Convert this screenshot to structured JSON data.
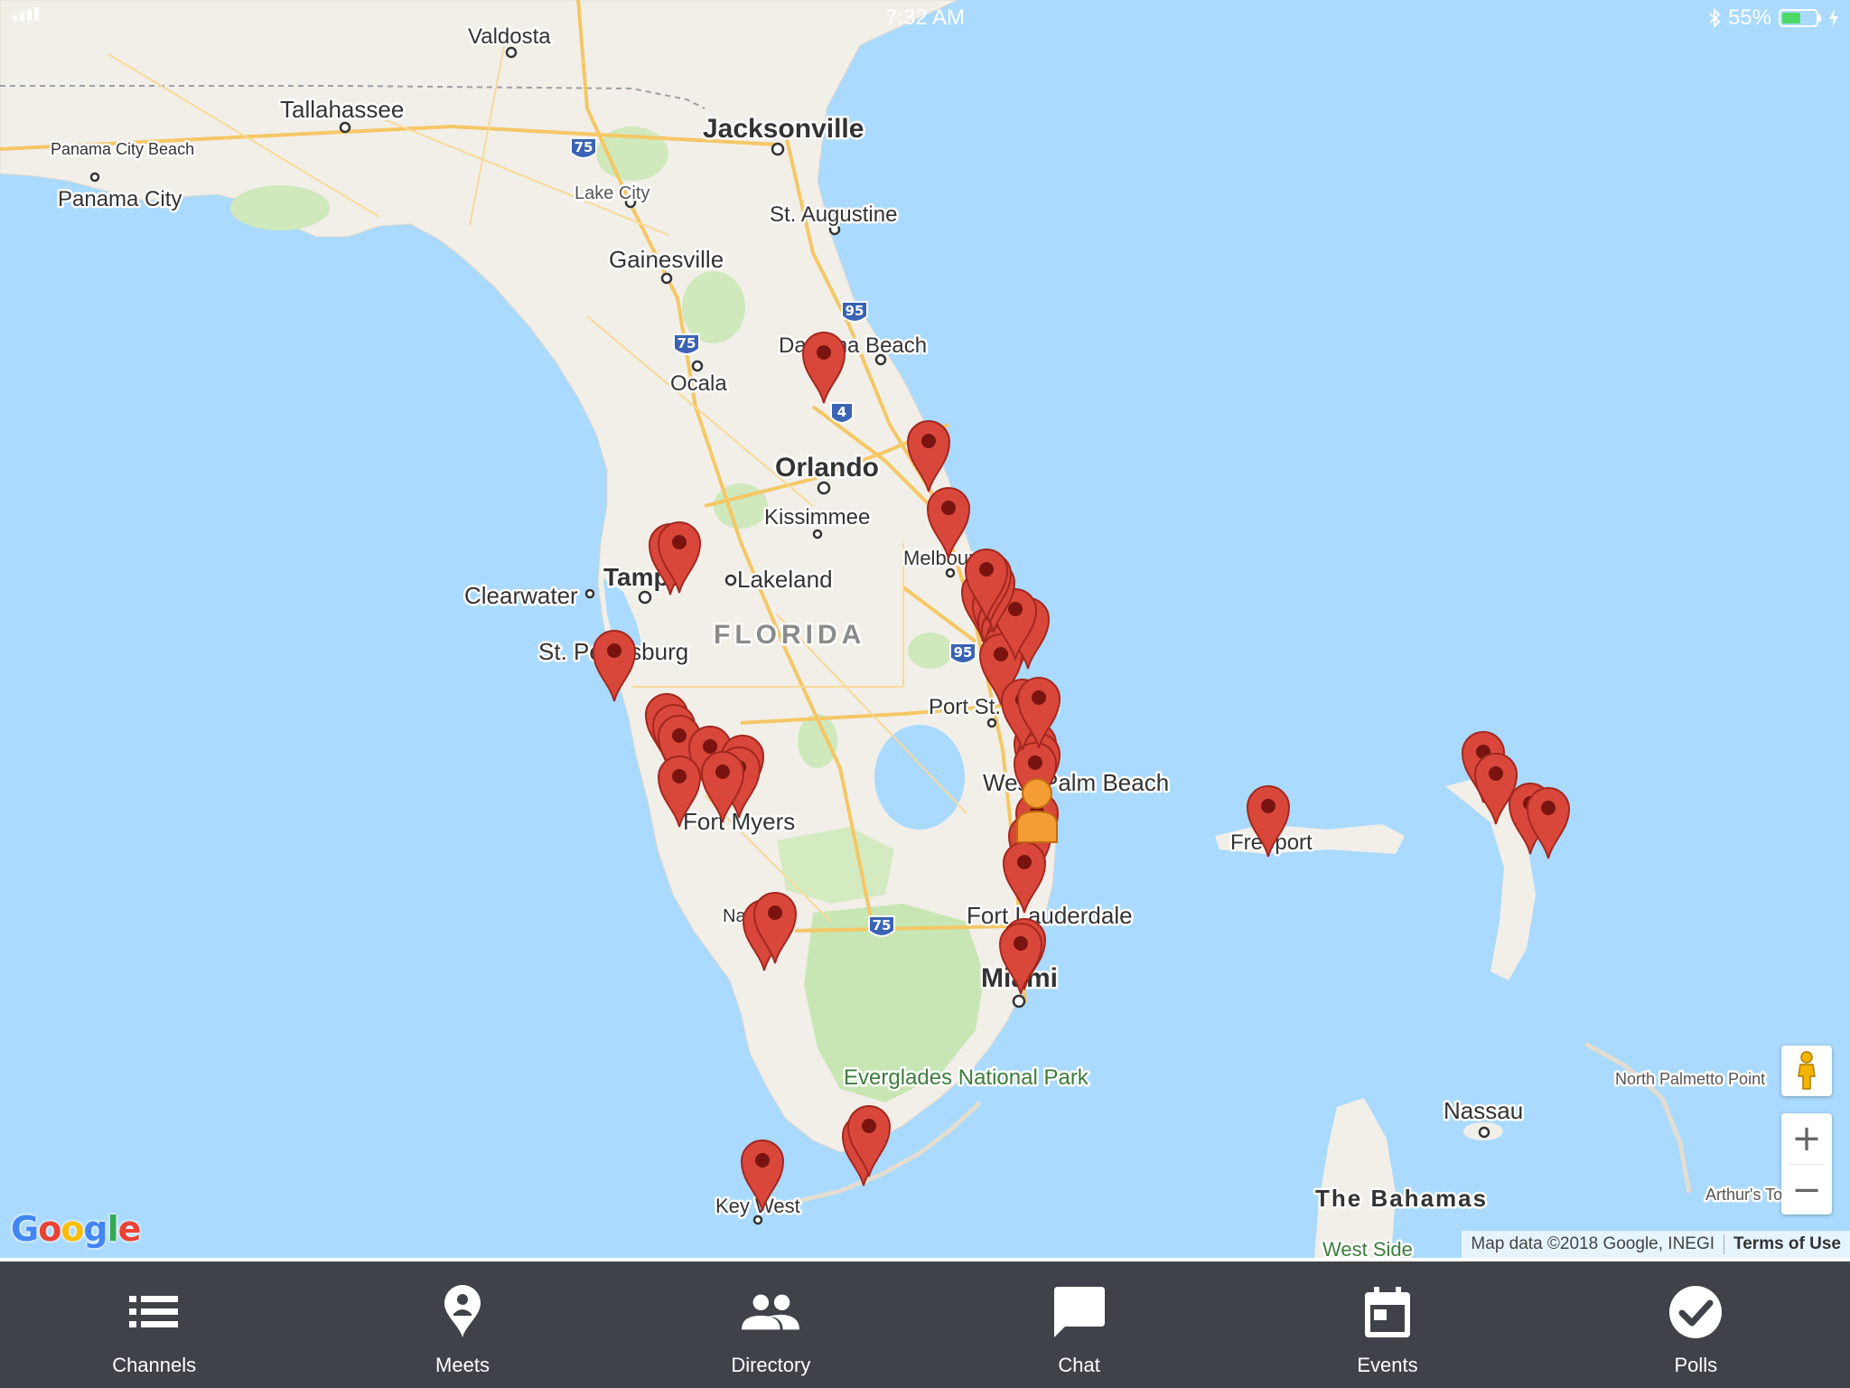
{
  "status_bar": {
    "time": "7:32 AM",
    "battery_percent": "55%",
    "battery_level": 0.55,
    "icons": [
      "signal-icon",
      "bluetooth-icon",
      "battery-icon",
      "charging-icon"
    ]
  },
  "colors": {
    "water": "#aadaff",
    "land": "#f2efe9",
    "park": "#c8e6b4",
    "highway": "#f7c96a",
    "pin": "#d9473b",
    "pin_dot": "#7a1410",
    "tabbar_bg": "#3f4349"
  },
  "map": {
    "labels": [
      {
        "text": "Valdosta",
        "size": "medium"
      },
      {
        "text": "Tallahassee",
        "size": "medium"
      },
      {
        "text": "Panama City Beach",
        "size": "small"
      },
      {
        "text": "Panama City",
        "size": "medium"
      },
      {
        "text": "Jacksonville",
        "size": "large"
      },
      {
        "text": "Lake City",
        "size": "small"
      },
      {
        "text": "St. Augustine",
        "size": "medium"
      },
      {
        "text": "Gainesville",
        "size": "medium"
      },
      {
        "text": "Daytona Beach",
        "size": "medium"
      },
      {
        "text": "Ocala",
        "size": "medium"
      },
      {
        "text": "Orlando",
        "size": "large"
      },
      {
        "text": "Kissimmee",
        "size": "medium"
      },
      {
        "text": "Melbourne",
        "size": "medium"
      },
      {
        "text": "Tampa",
        "size": "large"
      },
      {
        "text": "Lakeland",
        "size": "medium"
      },
      {
        "text": "Clearwater",
        "size": "medium"
      },
      {
        "text": "St. Petersburg",
        "size": "medium"
      },
      {
        "text": "FLORIDA",
        "size": "region"
      },
      {
        "text": "Port St. Lucie",
        "size": "medium"
      },
      {
        "text": "West Palm Beach",
        "size": "medium"
      },
      {
        "text": "Fort Myers",
        "size": "medium"
      },
      {
        "text": "Naples",
        "size": "small"
      },
      {
        "text": "Fort Lauderdale",
        "size": "medium"
      },
      {
        "text": "Miami",
        "size": "large"
      },
      {
        "text": "Everglades National Park",
        "size": "park"
      },
      {
        "text": "Key West",
        "size": "medium"
      },
      {
        "text": "Freeport",
        "size": "medium"
      },
      {
        "text": "Nassau",
        "size": "medium"
      },
      {
        "text": "North Palmetto Point",
        "size": "small"
      },
      {
        "text": "The Bahamas",
        "size": "country"
      },
      {
        "text": "Arthur's Town",
        "size": "small"
      },
      {
        "text": "West Side",
        "size": "park"
      }
    ],
    "shields": [
      "75",
      "75",
      "95",
      "4",
      "95",
      "75"
    ],
    "marker_count": 46,
    "user_location_icon": "person-location-icon"
  },
  "controls": {
    "pegman_icon": "pegman-icon",
    "zoom_in_label": "+",
    "zoom_out_label": "−",
    "google_logo": "Google",
    "attribution": "Map data ©2018 Google, INEGI",
    "terms": "Terms of Use"
  },
  "tabs": [
    {
      "label": "Channels",
      "icon": "list-icon"
    },
    {
      "label": "Meets",
      "icon": "location-pin-icon"
    },
    {
      "label": "Directory",
      "icon": "people-icon"
    },
    {
      "label": "Chat",
      "icon": "chat-bubble-icon"
    },
    {
      "label": "Events",
      "icon": "calendar-icon"
    },
    {
      "label": "Polls",
      "icon": "checkmark-circle-icon"
    }
  ]
}
